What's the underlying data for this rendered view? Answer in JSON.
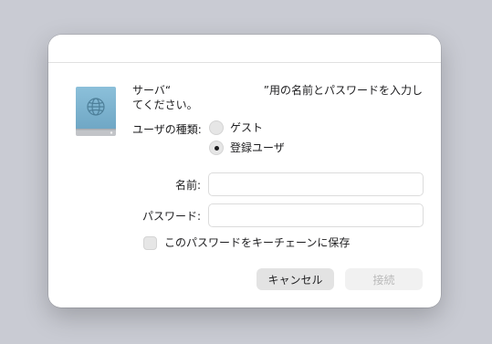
{
  "dialog": {
    "message_line1_prefix": "サーバ“",
    "message_line1_suffix": "”用の名前とパスワードを入力し",
    "message_line2": "てください。",
    "user_type_label": "ユーザの種類:",
    "user_type_options": [
      {
        "label": "ゲスト",
        "selected": false
      },
      {
        "label": "登録ユーザ",
        "selected": true
      }
    ],
    "name_label": "名前:",
    "name_value": "",
    "password_label": "パスワード:",
    "password_value": "",
    "save_password_label": "このパスワードをキーチェーンに保存",
    "save_password_checked": false,
    "cancel_label": "キャンセル",
    "connect_label": "接続",
    "icon": "network-server-icon",
    "colors": {
      "backdrop": "#c9cbd3",
      "icon_body": "#7fb3cf",
      "button_bg": "#e3e3e3",
      "disabled_text": "#b9b9b9"
    }
  }
}
